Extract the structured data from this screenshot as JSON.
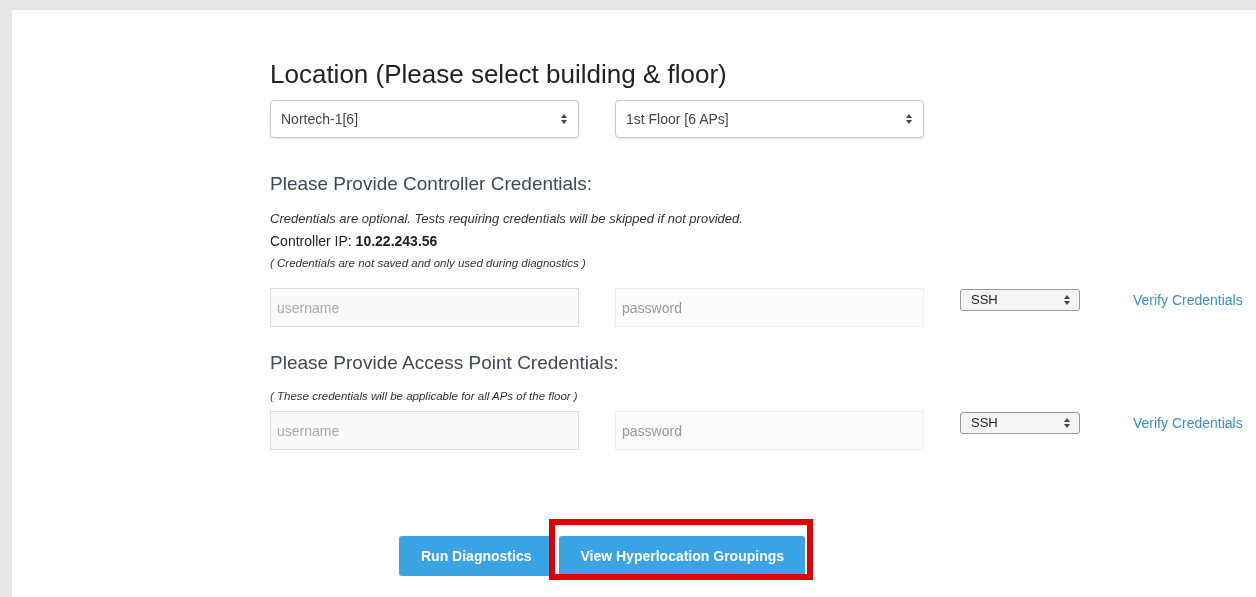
{
  "location": {
    "title": "Location (Please select building & floor)",
    "building": {
      "value": "Nortech-1[6]"
    },
    "floor": {
      "value": "1st Floor [6 APs]"
    }
  },
  "credential_sections": [
    {
      "title": "Please Provide Controller Credentials:",
      "notes": [
        {
          "kind": "optional",
          "text": "Credentials are optional. Tests requiring credentials will be skipped if not provided."
        },
        {
          "kind": "ip",
          "text": "Controller IP: **10.22.243.56**"
        },
        {
          "kind": "note",
          "text": "( Credentials are not saved and only used during diagnostics )"
        }
      ],
      "username": {
        "placeholder": "username"
      },
      "password": {
        "placeholder": "password"
      },
      "protocol": {
        "value": "SSH"
      },
      "link": "Verify Credentials"
    },
    {
      "title": "Please Provide Access Point Credentials:",
      "notes": [
        {
          "kind": "note",
          "text": "( These credentials will be applicable for all APs of the floor )"
        }
      ],
      "username": {
        "placeholder": "username"
      },
      "password": {
        "placeholder": "password"
      },
      "protocol": {
        "value": "SSH"
      },
      "link": "Verify Credentials"
    }
  ],
  "buttons": [
    {
      "label": "Run Diagnostics",
      "highlighted": false
    },
    {
      "label": "View Hyperlocation Groupings",
      "highlighted": true
    }
  ]
}
